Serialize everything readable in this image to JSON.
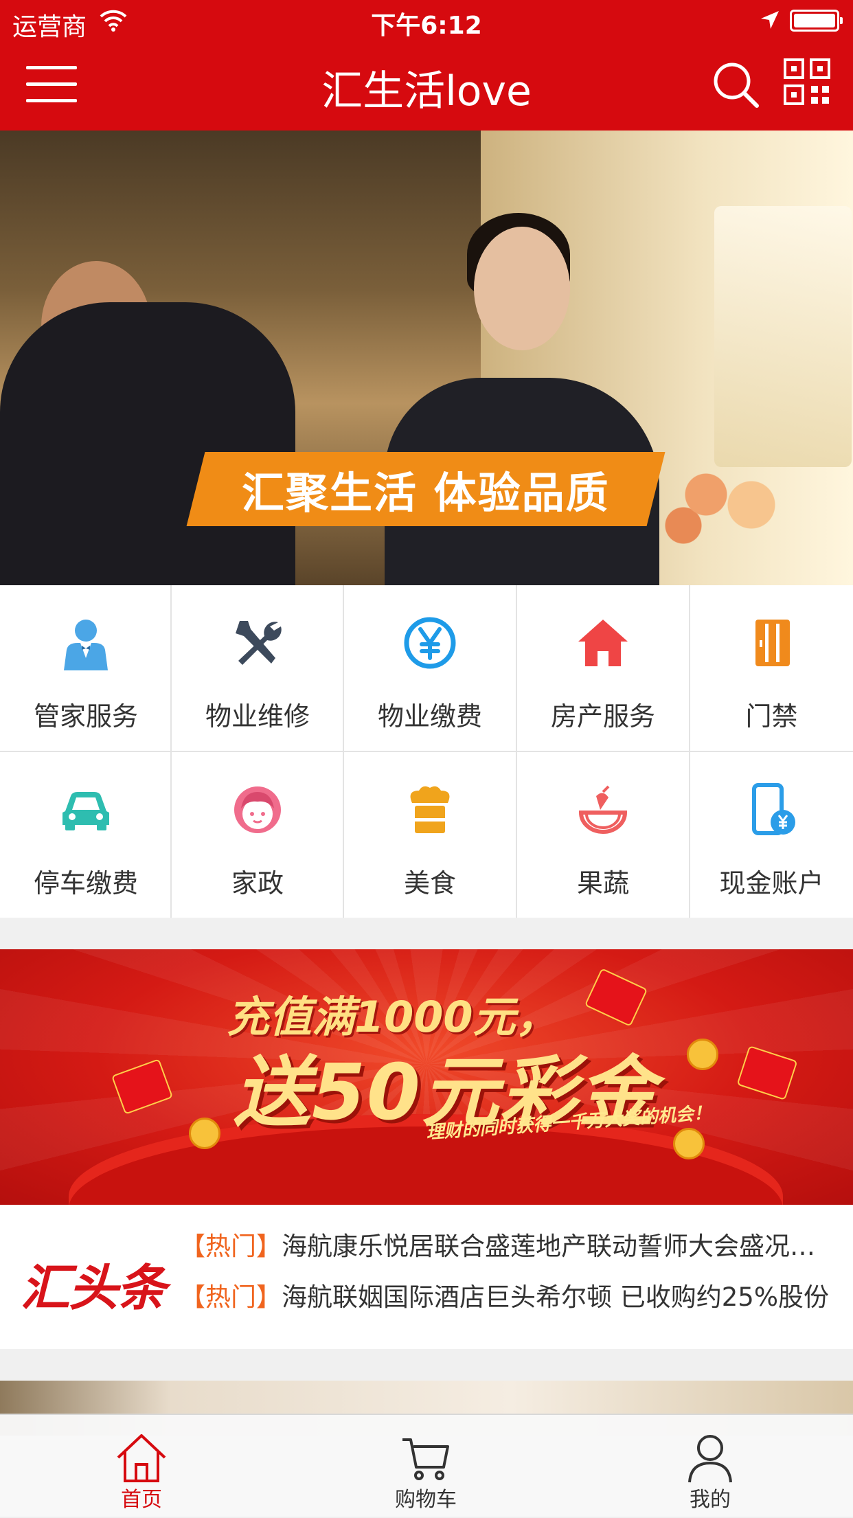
{
  "status_bar": {
    "carrier": "运营商",
    "time": "下午6:12"
  },
  "nav": {
    "title": "汇生活love",
    "menu_icon": "menu-icon",
    "search_icon": "search-icon",
    "qr_icon": "qr-code-icon"
  },
  "banner": {
    "slogan": "汇聚生活 体验品质",
    "pages": 3,
    "active_page": 1
  },
  "services": [
    {
      "label": "管家服务",
      "icon": "butler-icon",
      "color": "#4ba6e6"
    },
    {
      "label": "物业维修",
      "icon": "repair-tools-icon",
      "color": "#3d4a5c"
    },
    {
      "label": "物业缴费",
      "icon": "yuan-coin-icon",
      "color": "#1e9be8"
    },
    {
      "label": "房产服务",
      "icon": "house-icon",
      "color": "#ef4545"
    },
    {
      "label": "门禁",
      "icon": "door-access-icon",
      "color": "#f08a1c"
    },
    {
      "label": "停车缴费",
      "icon": "car-icon",
      "color": "#2ebdb0"
    },
    {
      "label": "家政",
      "icon": "housekeeper-icon",
      "color": "#f06c8c"
    },
    {
      "label": "美食",
      "icon": "chef-hat-icon",
      "color": "#f0a41c"
    },
    {
      "label": "果蔬",
      "icon": "fruit-icon",
      "color": "#ef5f5f"
    },
    {
      "label": "现金账户",
      "icon": "phone-wallet-icon",
      "color": "#2b9de8"
    }
  ],
  "promo": {
    "line1": "充值满1000元，",
    "line2": "送50元彩金",
    "line3": "理财的同时获得一千万大奖的机会！"
  },
  "news": {
    "logo": "汇头条",
    "items": [
      {
        "tag": "【热门】",
        "text": "海航康乐悦居联合盛莲地产联动誓师大会盛况空前"
      },
      {
        "tag": "【热门】",
        "text": "海航联姻国际酒店巨头希尔顿 已收购约25%股份"
      }
    ]
  },
  "tabbar": {
    "items": [
      {
        "label": "首页",
        "icon": "home-icon",
        "active": true
      },
      {
        "label": "购物车",
        "icon": "cart-icon",
        "active": false
      },
      {
        "label": "我的",
        "icon": "user-icon",
        "active": false
      }
    ]
  },
  "colors": {
    "brand_red": "#d60a0f",
    "hot_tag": "#f0641e",
    "active_dot": "#e10a10"
  }
}
